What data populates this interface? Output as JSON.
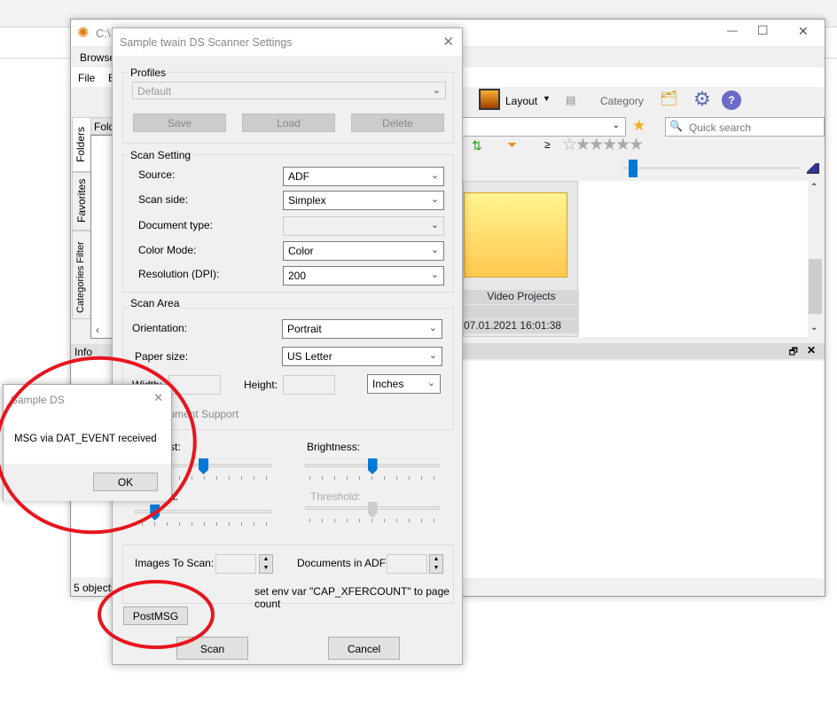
{
  "main_window": {
    "title": "C:\\",
    "menu_tab": "Browse",
    "menu": [
      "File",
      "E"
    ],
    "toolbar": {
      "layout": "Layout",
      "category": "Category"
    },
    "quick_search": "Quick search",
    "side_tabs": [
      "Folders",
      "Favorites",
      "Categories Filter"
    ],
    "folders_header": "Folders",
    "info_label": "Info",
    "status": "5 objects",
    "folder": {
      "name": "Video Projects",
      "date": "07.01.2021 16:01:38"
    },
    "window_controls": [
      "—",
      "☐",
      "✕"
    ]
  },
  "dialog": {
    "title": "Sample twain DS Scanner Settings",
    "profiles": {
      "label": "Profiles",
      "value": "Default",
      "save": "Save",
      "load": "Load",
      "delete": "Delete"
    },
    "scan_setting": {
      "label": "Scan Setting",
      "rows": [
        {
          "label": "Source:",
          "value": "ADF"
        },
        {
          "label": "Scan side:",
          "value": "Simplex"
        },
        {
          "label": "Document type:",
          "value": ""
        },
        {
          "label": "Color Mode:",
          "value": "Color"
        },
        {
          "label": "Resolution (DPI):",
          "value": "200"
        }
      ]
    },
    "scan_area": {
      "label": "Scan Area",
      "orientation_label": "Orientation:",
      "orientation": "Portrait",
      "paper_label": "Paper size:",
      "paper": "US Letter",
      "width_label": "Width:",
      "height_label": "Height:",
      "units": "Inches",
      "doc_support": "Document Support"
    },
    "contrast_label": "Contrast:",
    "brightness_label": "Brightness:",
    "gamma_label": "Gamma:",
    "threshold_label": "Threshold:",
    "images_label": "Images To Scan:",
    "docs_label": "Documents in ADF:",
    "hint": "set env var \"CAP_XFERCOUNT\" to page count",
    "postmsg": "PostMSG",
    "scan": "Scan",
    "cancel": "Cancel",
    "sliders": {
      "contrast": 0.5,
      "gamma": 0.12,
      "brightness": 0.5,
      "threshold": 0.5
    }
  },
  "msgbox": {
    "title": "Sample DS",
    "message": "MSG via DAT_EVENT received",
    "ok": "OK"
  },
  "colors": {
    "annotation": "#e8141e",
    "accent": "#0078d7"
  }
}
